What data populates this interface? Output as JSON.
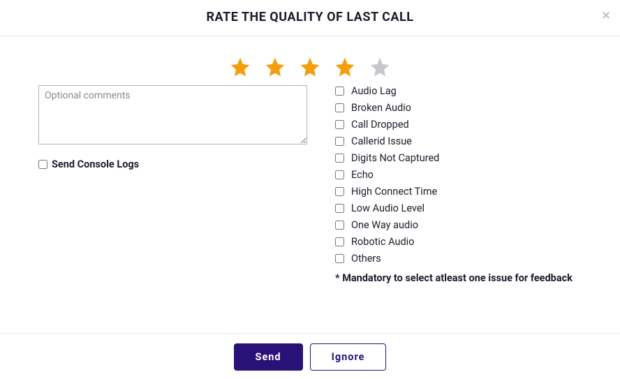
{
  "header": {
    "title": "RATE THE QUALITY OF LAST CALL",
    "close_glyph": "×"
  },
  "rating": {
    "value": 4,
    "max": 5
  },
  "comments": {
    "placeholder": "Optional comments",
    "value": ""
  },
  "console_logs": {
    "label": "Send Console Logs",
    "checked": false
  },
  "issues": [
    {
      "label": "Audio Lag",
      "checked": false
    },
    {
      "label": "Broken Audio",
      "checked": false
    },
    {
      "label": "Call Dropped",
      "checked": false
    },
    {
      "label": "Callerid Issue",
      "checked": false
    },
    {
      "label": "Digits Not Captured",
      "checked": false
    },
    {
      "label": "Echo",
      "checked": false
    },
    {
      "label": "High Connect Time",
      "checked": false
    },
    {
      "label": "Low Audio Level",
      "checked": false
    },
    {
      "label": "One Way audio",
      "checked": false
    },
    {
      "label": "Robotic Audio",
      "checked": false
    },
    {
      "label": "Others",
      "checked": false
    }
  ],
  "mandatory_note": "* Mandatory to select atleast one issue for feedback",
  "footer": {
    "send_label": "Send",
    "ignore_label": "Ignore"
  },
  "colors": {
    "primary": "#2a1178",
    "star_filled": "#f59e0b",
    "star_empty": "#c7c7cc"
  }
}
